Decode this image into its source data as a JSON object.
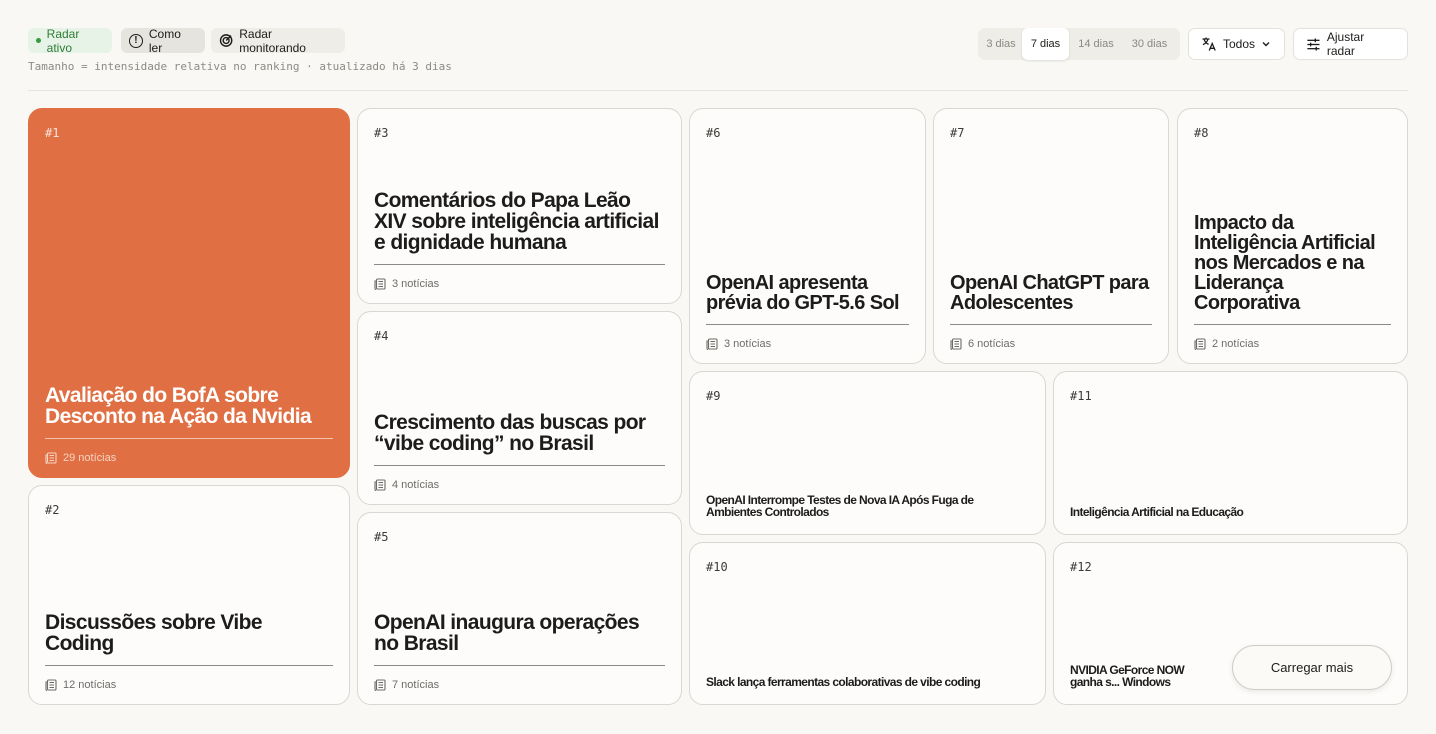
{
  "header": {
    "status_label": "Radar ativo",
    "how_to_read_label": "Como ler",
    "monitoring_label": "Radar monitorando",
    "subtitle": "Tamanho = intensidade relativa no ranking · atualizado há 3 dias",
    "periods": [
      "3 dias",
      "7 dias",
      "14 dias",
      "30 dias"
    ],
    "active_period": "7 dias",
    "language_label": "Todos",
    "adjust_label": "Ajustar radar"
  },
  "cards": [
    {
      "rank": "#1",
      "title": "Avaliação do BofA sobre Desconto na Ação da Nvidia",
      "count": "29 notícias"
    },
    {
      "rank": "#2",
      "title": "Discussões sobre Vibe Coding",
      "count": "12 notícias"
    },
    {
      "rank": "#3",
      "title": "Comentários do Papa Leão XIV sobre inteligência artificial e dignidade humana",
      "count": "3 notícias"
    },
    {
      "rank": "#4",
      "title": "Crescimento das buscas por “vibe coding” no Brasil",
      "count": "4 notícias"
    },
    {
      "rank": "#5",
      "title": "OpenAI inaugura operações no Brasil",
      "count": "7 notícias"
    },
    {
      "rank": "#6",
      "title": "OpenAI apresenta prévia do GPT-5.6 Sol",
      "count": "3 notícias"
    },
    {
      "rank": "#7",
      "title": "OpenAI ChatGPT para Adolescentes",
      "count": "6 notícias"
    },
    {
      "rank": "#8",
      "title": "Impacto da Inteligência Artificial nos Mercados e na Liderança Corporativa",
      "count": "2 notícias"
    },
    {
      "rank": "#9",
      "title": "OpenAI Interrompe Testes de Nova IA Após Fuga de Ambientes Controlados"
    },
    {
      "rank": "#10",
      "title": "Slack lança ferramentas colaborativas de vibe coding"
    },
    {
      "rank": "#11",
      "title": "Inteligência Artificial na Educação"
    },
    {
      "rank": "#12",
      "title": "NVIDIA GeForce NOW ganha s... Windows"
    }
  ],
  "load_more_label": "Carregar mais",
  "colors": {
    "hot": "#e07043",
    "status": "#2e7c37"
  },
  "icons": [
    "info-icon",
    "radar-icon",
    "translate-icon",
    "chevron-down-icon",
    "sliders-icon",
    "news-icon"
  ]
}
